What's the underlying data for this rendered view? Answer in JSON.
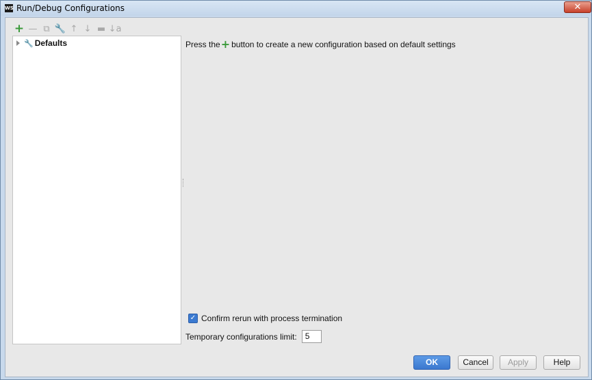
{
  "window": {
    "app_icon_text": "WS",
    "title": "Run/Debug Configurations",
    "close_symbol": "✕"
  },
  "toolbar": {
    "items": [
      {
        "name": "add",
        "glyph": "+",
        "icon": "plus-icon"
      },
      {
        "name": "remove",
        "glyph": "—",
        "icon": "minus-icon"
      },
      {
        "name": "copy",
        "glyph": "⧉",
        "icon": "copy-icon"
      },
      {
        "name": "edit-defaults",
        "glyph": "🔧",
        "icon": "wrench-icon"
      },
      {
        "name": "move-up",
        "glyph": "↑",
        "icon": "arrow-up-icon"
      },
      {
        "name": "move-down",
        "glyph": "↓",
        "icon": "arrow-down-icon"
      },
      {
        "name": "folder",
        "glyph": "▬",
        "icon": "folder-icon"
      },
      {
        "name": "sort",
        "glyph": "↓a",
        "icon": "sort-icon"
      }
    ]
  },
  "tree": {
    "root_label": "Defaults",
    "root_icon": "🔧"
  },
  "hint": {
    "before": "Press the",
    "plus": "+",
    "after": "button to create a new configuration based on default settings"
  },
  "confirm": {
    "checked": true,
    "check_glyph": "✓",
    "label": "Confirm rerun with process termination"
  },
  "limit": {
    "label": "Temporary configurations limit:",
    "value": "5"
  },
  "buttons": {
    "ok": "OK",
    "cancel": "Cancel",
    "apply": "Apply",
    "help": "Help"
  },
  "colors": {
    "accent": "#3b78cf",
    "add_green": "#3a9a3a"
  }
}
